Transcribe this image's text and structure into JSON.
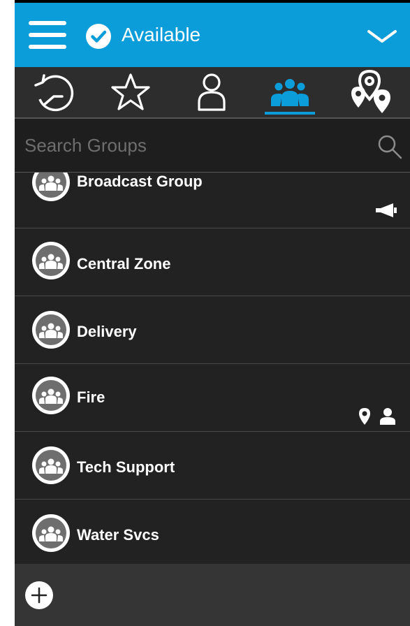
{
  "header": {
    "status_label": "Available",
    "accent_color": "#0b9cda"
  },
  "tabs": [
    {
      "name": "history-icon",
      "selected": false
    },
    {
      "name": "star-icon",
      "selected": false
    },
    {
      "name": "contact-icon",
      "selected": false
    },
    {
      "name": "groups-icon",
      "selected": true
    },
    {
      "name": "map-pins-icon",
      "selected": false
    }
  ],
  "search": {
    "placeholder": "Search Groups",
    "value": ""
  },
  "groups": [
    {
      "label": "Broadcast Group",
      "badges": [
        "megaphone-icon"
      ]
    },
    {
      "label": "Central Zone",
      "badges": []
    },
    {
      "label": "Delivery",
      "badges": []
    },
    {
      "label": "Fire",
      "badges": [
        "location-pin-icon",
        "person-icon"
      ]
    },
    {
      "label": "Tech Support",
      "badges": []
    },
    {
      "label": "Water Svcs",
      "badges": []
    }
  ],
  "footer": {
    "add_icon": "plus-icon"
  }
}
